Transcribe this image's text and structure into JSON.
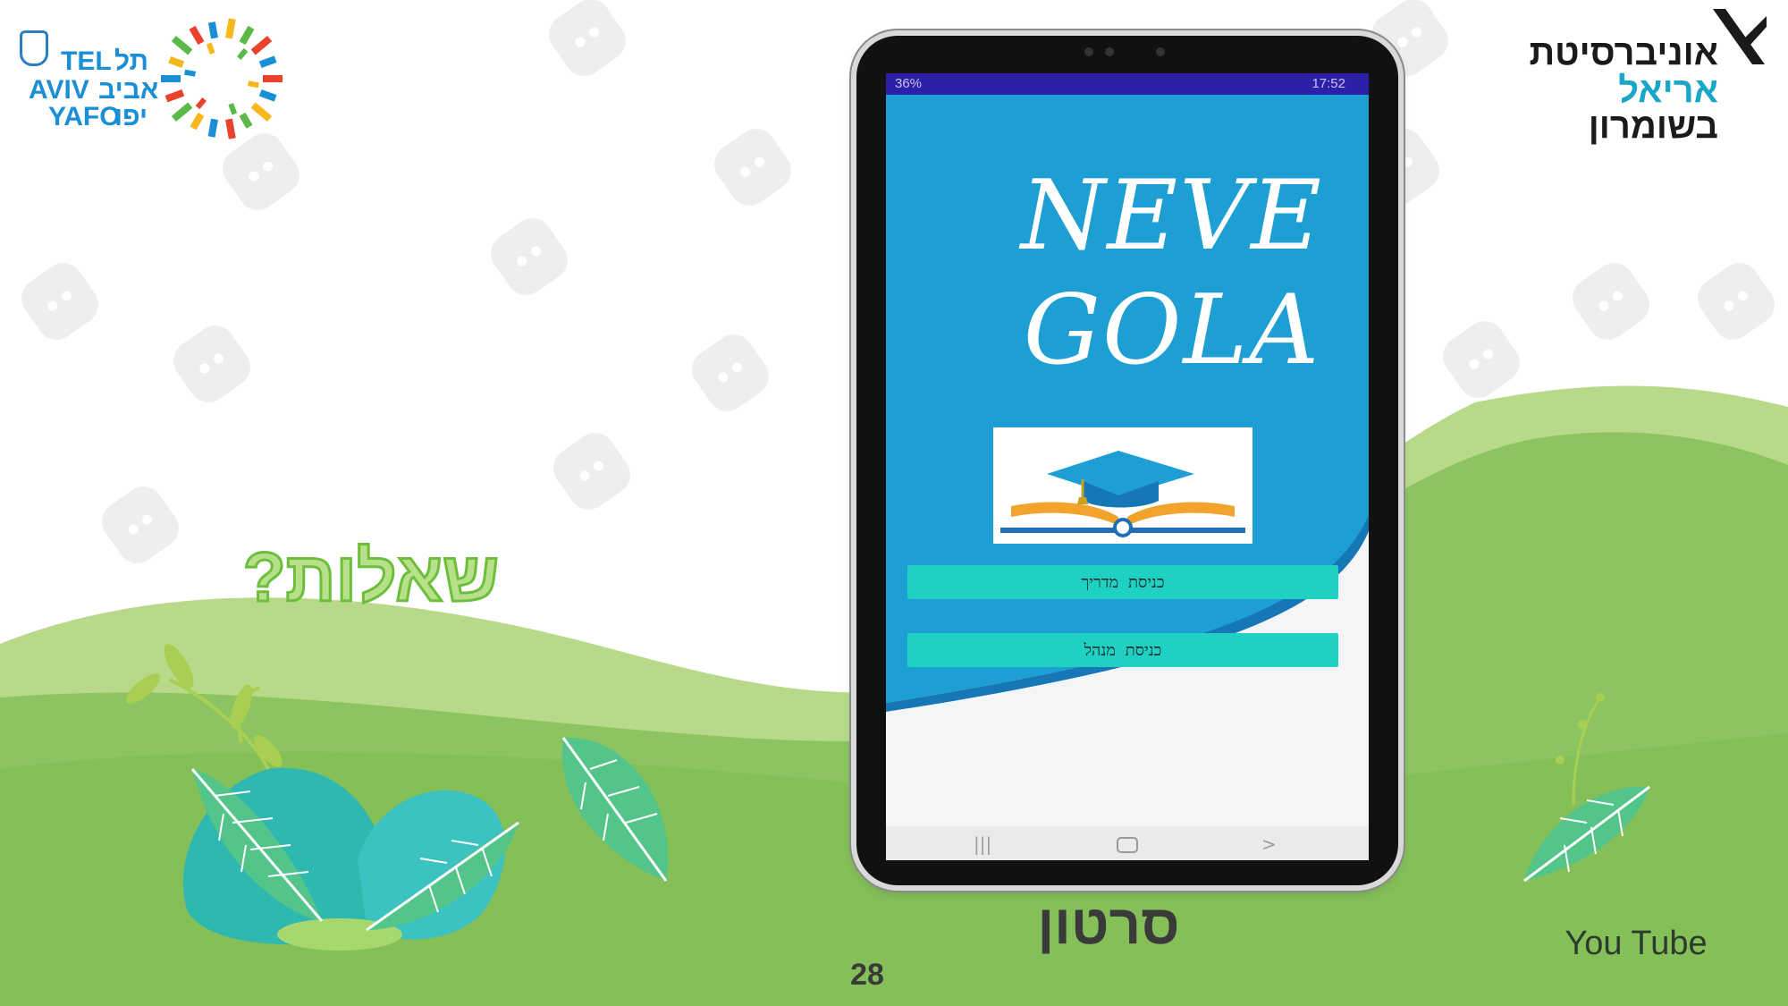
{
  "slide": {
    "questions_text": "שאלות?",
    "video_label": "סרטון",
    "page_number": "28",
    "youtube_link": "You Tube"
  },
  "logos": {
    "tel_aviv": {
      "latin_tel": "TEL",
      "latin_aviv": "AVIV",
      "latin_yafo": "YAFO",
      "hebrew_tel": "תל",
      "hebrew_aviv": "אביב",
      "hebrew_yafo": "יפו"
    },
    "ariel": {
      "line1": "אוניברסיטת",
      "line2": "אריאל",
      "line3": "בשומרון",
      "accent_color": "#1aa6c9"
    }
  },
  "app": {
    "status": {
      "left": "36%",
      "right": "17:52"
    },
    "title_line1": "NEVE",
    "title_line2": "GOLA",
    "buttons": {
      "guide_entry": "כניסת מדריך",
      "manager_entry": "כניסת מנהל"
    },
    "nav_icons": [
      "recent-apps-icon",
      "home-icon",
      "back-icon"
    ]
  },
  "colors": {
    "hill_light": "#b8d98a",
    "hill_main": "#8cc461",
    "app_blue": "#1ea2d4",
    "app_button": "#1fd1c2",
    "status_bar": "#2e1fa8",
    "questions_stroke": "#6bbf3b"
  }
}
